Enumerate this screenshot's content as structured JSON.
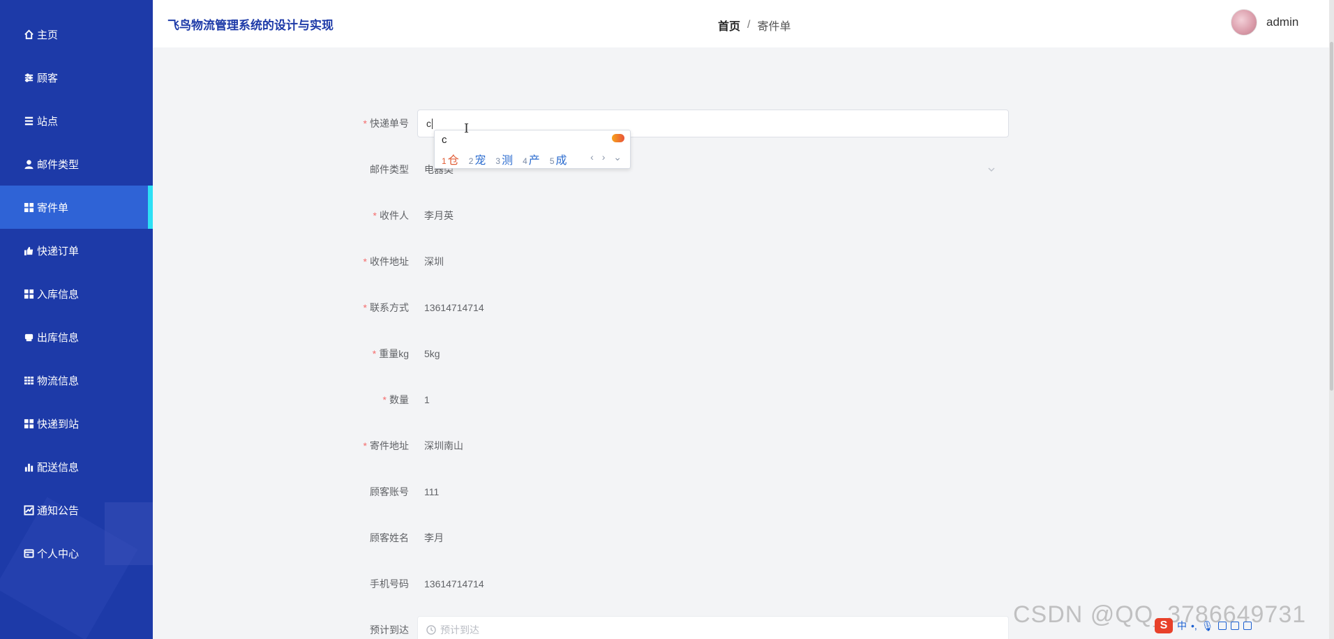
{
  "header": {
    "app_title": "飞鸟物流管理系统的设计与实现",
    "breadcrumb_home": "首页",
    "breadcrumb_sep": "/",
    "breadcrumb_current": "寄件单",
    "username": "admin"
  },
  "sidebar": {
    "items": [
      {
        "label": "主页",
        "icon": "home-icon"
      },
      {
        "label": "顾客",
        "icon": "sliders-icon"
      },
      {
        "label": "站点",
        "icon": "list-icon"
      },
      {
        "label": "邮件类型",
        "icon": "user-icon"
      },
      {
        "label": "寄件单",
        "icon": "grid-icon",
        "active": true
      },
      {
        "label": "快递订单",
        "icon": "thumbs-up-icon"
      },
      {
        "label": "入库信息",
        "icon": "grid-icon"
      },
      {
        "label": "出库信息",
        "icon": "printer-icon"
      },
      {
        "label": "物流信息",
        "icon": "table-icon"
      },
      {
        "label": "快递到站",
        "icon": "grid-icon"
      },
      {
        "label": "配送信息",
        "icon": "bar-chart-icon"
      },
      {
        "label": "通知公告",
        "icon": "line-chart-icon"
      },
      {
        "label": "个人中心",
        "icon": "card-icon"
      }
    ]
  },
  "form": {
    "tracking_no": {
      "label": "快递单号",
      "value": "c",
      "required": true
    },
    "mail_type": {
      "label": "邮件类型",
      "value": "电器类"
    },
    "recipient": {
      "label": "收件人",
      "value": "李月英",
      "required": true
    },
    "recipient_address": {
      "label": "收件地址",
      "value": "深圳",
      "required": true
    },
    "contact": {
      "label": "联系方式",
      "value": "13614714714",
      "required": true
    },
    "weight": {
      "label": "重量kg",
      "value": "5kg",
      "required": true
    },
    "quantity": {
      "label": "数量",
      "value": "1",
      "required": true
    },
    "sender_address": {
      "label": "寄件地址",
      "value": "深圳南山",
      "required": true
    },
    "customer_account": {
      "label": "顾客账号",
      "value": "111"
    },
    "customer_name": {
      "label": "顾客姓名",
      "value": "李月"
    },
    "phone": {
      "label": "手机号码",
      "value": "13614714714"
    },
    "eta": {
      "label": "预计到达",
      "placeholder": "预计到达"
    }
  },
  "ime": {
    "input": "c",
    "candidates": [
      {
        "n": "1",
        "text": "仓"
      },
      {
        "n": "2",
        "text": "宠"
      },
      {
        "n": "3",
        "text": "测"
      },
      {
        "n": "4",
        "text": "产"
      },
      {
        "n": "5",
        "text": "成"
      }
    ],
    "nav": "‹ › ⌄"
  },
  "watermark": "CSDN @QQ_3786649731",
  "taskbar": {
    "ime_mode": "中",
    "logo": "S"
  },
  "colors": {
    "sidebar": "#1d3aa8",
    "active_item": "#2f63d6",
    "active_marker": "#2ee0f5",
    "required": "#f56c6c"
  }
}
